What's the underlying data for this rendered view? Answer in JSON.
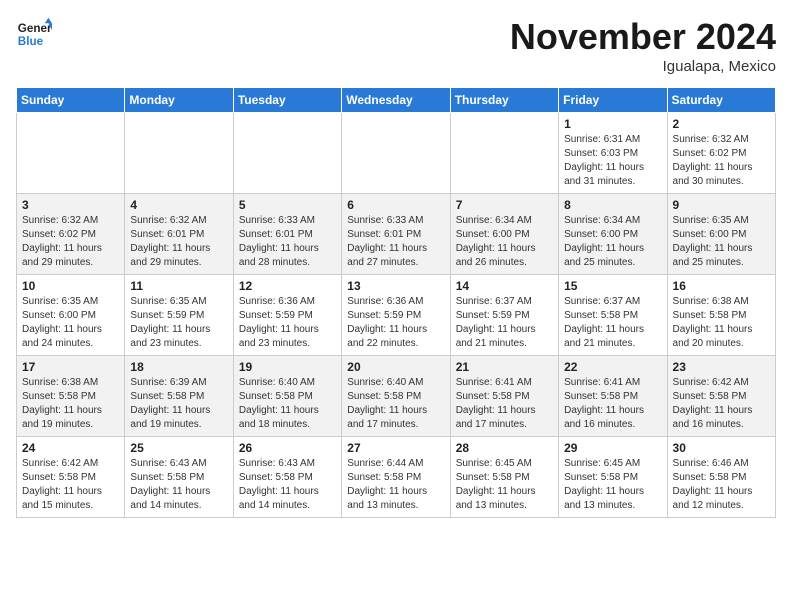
{
  "header": {
    "logo_line1": "General",
    "logo_line2": "Blue",
    "title": "November 2024",
    "subtitle": "Igualapa, Mexico"
  },
  "weekdays": [
    "Sunday",
    "Monday",
    "Tuesday",
    "Wednesday",
    "Thursday",
    "Friday",
    "Saturday"
  ],
  "weeks": [
    [
      {
        "day": "",
        "info": ""
      },
      {
        "day": "",
        "info": ""
      },
      {
        "day": "",
        "info": ""
      },
      {
        "day": "",
        "info": ""
      },
      {
        "day": "",
        "info": ""
      },
      {
        "day": "1",
        "info": "Sunrise: 6:31 AM\nSunset: 6:03 PM\nDaylight: 11 hours\nand 31 minutes."
      },
      {
        "day": "2",
        "info": "Sunrise: 6:32 AM\nSunset: 6:02 PM\nDaylight: 11 hours\nand 30 minutes."
      }
    ],
    [
      {
        "day": "3",
        "info": "Sunrise: 6:32 AM\nSunset: 6:02 PM\nDaylight: 11 hours\nand 29 minutes."
      },
      {
        "day": "4",
        "info": "Sunrise: 6:32 AM\nSunset: 6:01 PM\nDaylight: 11 hours\nand 29 minutes."
      },
      {
        "day": "5",
        "info": "Sunrise: 6:33 AM\nSunset: 6:01 PM\nDaylight: 11 hours\nand 28 minutes."
      },
      {
        "day": "6",
        "info": "Sunrise: 6:33 AM\nSunset: 6:01 PM\nDaylight: 11 hours\nand 27 minutes."
      },
      {
        "day": "7",
        "info": "Sunrise: 6:34 AM\nSunset: 6:00 PM\nDaylight: 11 hours\nand 26 minutes."
      },
      {
        "day": "8",
        "info": "Sunrise: 6:34 AM\nSunset: 6:00 PM\nDaylight: 11 hours\nand 25 minutes."
      },
      {
        "day": "9",
        "info": "Sunrise: 6:35 AM\nSunset: 6:00 PM\nDaylight: 11 hours\nand 25 minutes."
      }
    ],
    [
      {
        "day": "10",
        "info": "Sunrise: 6:35 AM\nSunset: 6:00 PM\nDaylight: 11 hours\nand 24 minutes."
      },
      {
        "day": "11",
        "info": "Sunrise: 6:35 AM\nSunset: 5:59 PM\nDaylight: 11 hours\nand 23 minutes."
      },
      {
        "day": "12",
        "info": "Sunrise: 6:36 AM\nSunset: 5:59 PM\nDaylight: 11 hours\nand 23 minutes."
      },
      {
        "day": "13",
        "info": "Sunrise: 6:36 AM\nSunset: 5:59 PM\nDaylight: 11 hours\nand 22 minutes."
      },
      {
        "day": "14",
        "info": "Sunrise: 6:37 AM\nSunset: 5:59 PM\nDaylight: 11 hours\nand 21 minutes."
      },
      {
        "day": "15",
        "info": "Sunrise: 6:37 AM\nSunset: 5:58 PM\nDaylight: 11 hours\nand 21 minutes."
      },
      {
        "day": "16",
        "info": "Sunrise: 6:38 AM\nSunset: 5:58 PM\nDaylight: 11 hours\nand 20 minutes."
      }
    ],
    [
      {
        "day": "17",
        "info": "Sunrise: 6:38 AM\nSunset: 5:58 PM\nDaylight: 11 hours\nand 19 minutes."
      },
      {
        "day": "18",
        "info": "Sunrise: 6:39 AM\nSunset: 5:58 PM\nDaylight: 11 hours\nand 19 minutes."
      },
      {
        "day": "19",
        "info": "Sunrise: 6:40 AM\nSunset: 5:58 PM\nDaylight: 11 hours\nand 18 minutes."
      },
      {
        "day": "20",
        "info": "Sunrise: 6:40 AM\nSunset: 5:58 PM\nDaylight: 11 hours\nand 17 minutes."
      },
      {
        "day": "21",
        "info": "Sunrise: 6:41 AM\nSunset: 5:58 PM\nDaylight: 11 hours\nand 17 minutes."
      },
      {
        "day": "22",
        "info": "Sunrise: 6:41 AM\nSunset: 5:58 PM\nDaylight: 11 hours\nand 16 minutes."
      },
      {
        "day": "23",
        "info": "Sunrise: 6:42 AM\nSunset: 5:58 PM\nDaylight: 11 hours\nand 16 minutes."
      }
    ],
    [
      {
        "day": "24",
        "info": "Sunrise: 6:42 AM\nSunset: 5:58 PM\nDaylight: 11 hours\nand 15 minutes."
      },
      {
        "day": "25",
        "info": "Sunrise: 6:43 AM\nSunset: 5:58 PM\nDaylight: 11 hours\nand 14 minutes."
      },
      {
        "day": "26",
        "info": "Sunrise: 6:43 AM\nSunset: 5:58 PM\nDaylight: 11 hours\nand 14 minutes."
      },
      {
        "day": "27",
        "info": "Sunrise: 6:44 AM\nSunset: 5:58 PM\nDaylight: 11 hours\nand 13 minutes."
      },
      {
        "day": "28",
        "info": "Sunrise: 6:45 AM\nSunset: 5:58 PM\nDaylight: 11 hours\nand 13 minutes."
      },
      {
        "day": "29",
        "info": "Sunrise: 6:45 AM\nSunset: 5:58 PM\nDaylight: 11 hours\nand 13 minutes."
      },
      {
        "day": "30",
        "info": "Sunrise: 6:46 AM\nSunset: 5:58 PM\nDaylight: 11 hours\nand 12 minutes."
      }
    ]
  ]
}
